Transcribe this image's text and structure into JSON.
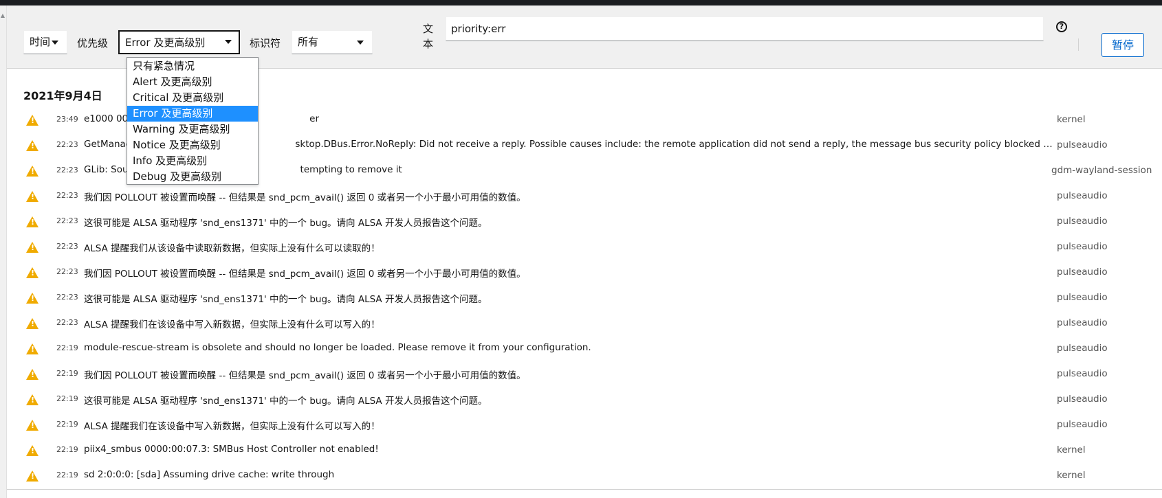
{
  "filters": {
    "time_label": "时间",
    "priority_label": "优先级",
    "priority_value": "Error 及更高级别",
    "identifier_label": "标识符",
    "identifier_value": "所有",
    "text_label_line1": "文",
    "text_label_line2": "本",
    "text_value": "priority:err",
    "help_glyph": "?",
    "pause_label": "暂停"
  },
  "priority_options": [
    "只有紧急情况",
    "Alert 及更高级别",
    "Critical 及更高级别",
    "Error 及更高级别",
    "Warning 及更高级别",
    "Notice 及更高级别",
    "Info 及更高级别",
    "Debug 及更高级别"
  ],
  "priority_selected_index": 3,
  "date_heading": "2021年9月4日",
  "log_entries": [
    {
      "time": "23:49",
      "message": "e1000 00",
      "message_tail": "er",
      "identifier": "kernel"
    },
    {
      "time": "22:23",
      "message": "GetManag",
      "message_tail": "sktop.DBus.Error.NoReply: Did not receive a reply. Possible causes include: the remote application did not send a reply, the message bus security policy blocked the reply, the reply timeo...",
      "identifier": "pulseaudio"
    },
    {
      "time": "22:23",
      "message": "GLib: Sou",
      "message_tail": "tempting to remove it",
      "identifier": "gdm-wayland-session"
    },
    {
      "time": "22:23",
      "message": "我们因 POLLOUT 被设置而唤醒 -- 但结果是 snd_pcm_avail() 返回 0 或者另一个小于最小可用值的数值。",
      "message_tail": "",
      "identifier": "pulseaudio"
    },
    {
      "time": "22:23",
      "message": "这很可能是 ALSA 驱动程序 'snd_ens1371' 中的一个 bug。请向 ALSA 开发人员报告这个问题。",
      "message_tail": "",
      "identifier": "pulseaudio"
    },
    {
      "time": "22:23",
      "message": "ALSA 提醒我们从该设备中读取新数据，但实际上没有什么可以读取的！",
      "message_tail": "",
      "identifier": "pulseaudio"
    },
    {
      "time": "22:23",
      "message": "我们因 POLLOUT 被设置而唤醒 -- 但结果是 snd_pcm_avail() 返回 0 或者另一个小于最小可用值的数值。",
      "message_tail": "",
      "identifier": "pulseaudio"
    },
    {
      "time": "22:23",
      "message": "这很可能是 ALSA 驱动程序 'snd_ens1371' 中的一个 bug。请向 ALSA 开发人员报告这个问题。",
      "message_tail": "",
      "identifier": "pulseaudio"
    },
    {
      "time": "22:23",
      "message": "ALSA 提醒我们在该设备中写入新数据，但实际上没有什么可以写入的！",
      "message_tail": "",
      "identifier": "pulseaudio"
    },
    {
      "time": "22:19",
      "message": "module-rescue-stream is obsolete and should no longer be loaded. Please remove it from your configuration.",
      "message_tail": "",
      "identifier": "pulseaudio"
    },
    {
      "time": "22:19",
      "message": "我们因 POLLOUT 被设置而唤醒 -- 但结果是 snd_pcm_avail() 返回 0 或者另一个小于最小可用值的数值。",
      "message_tail": "",
      "identifier": "pulseaudio"
    },
    {
      "time": "22:19",
      "message": "这很可能是 ALSA 驱动程序 'snd_ens1371' 中的一个 bug。请向 ALSA 开发人员报告这个问题。",
      "message_tail": "",
      "identifier": "pulseaudio"
    },
    {
      "time": "22:19",
      "message": "ALSA 提醒我们在该设备中写入新数据，但实际上没有什么可以写入的！",
      "message_tail": "",
      "identifier": "pulseaudio"
    },
    {
      "time": "22:19",
      "message": "piix4_smbus 0000:00:07.3: SMBus Host Controller not enabled!",
      "message_tail": "",
      "identifier": "kernel"
    },
    {
      "time": "22:19",
      "message": "sd 2:0:0:0: [sda] Assuming drive cache: write through",
      "message_tail": "",
      "identifier": "kernel"
    }
  ],
  "colors": {
    "accent": "#0066cc",
    "warning": "#f0ab00",
    "selected_option": "#1e90ff"
  }
}
